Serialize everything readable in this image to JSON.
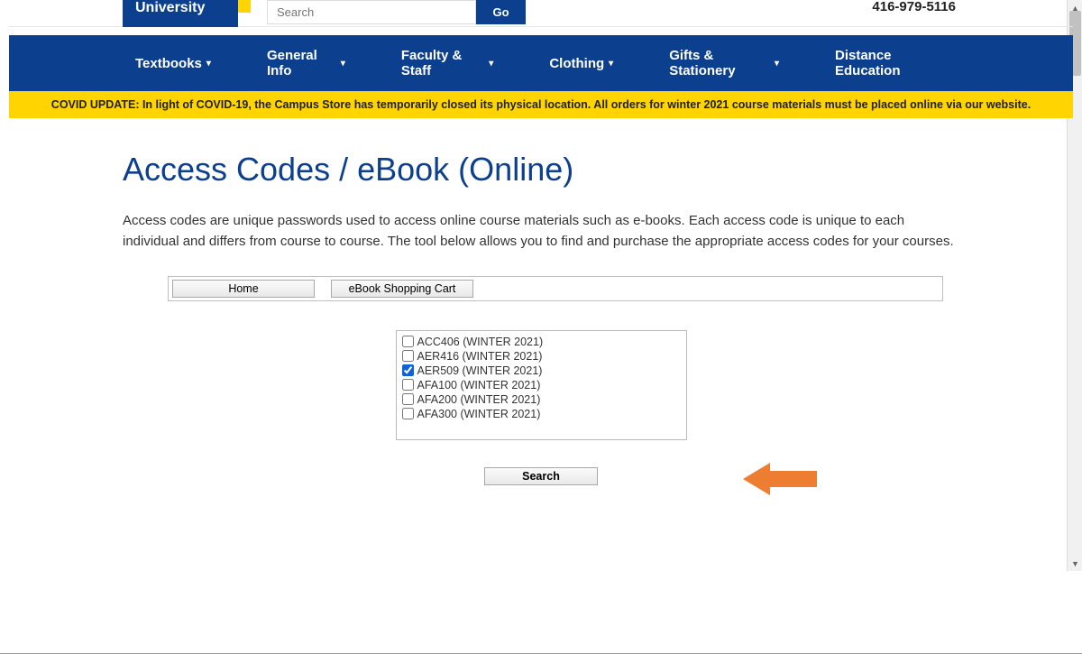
{
  "header": {
    "logo_text": "University",
    "search_placeholder": "Search",
    "search_button": "Go",
    "phone": "416-979-5116"
  },
  "nav": {
    "items": [
      {
        "label": "Textbooks",
        "has_dropdown": true
      },
      {
        "label": "General Info",
        "has_dropdown": true
      },
      {
        "label": "Faculty & Staff",
        "has_dropdown": true
      },
      {
        "label": "Clothing",
        "has_dropdown": true
      },
      {
        "label": "Gifts & Stationery",
        "has_dropdown": true
      },
      {
        "label": "Distance Education",
        "has_dropdown": false
      }
    ]
  },
  "notice": "COVID UPDATE: In light of COVID-19, the Campus Store has temporarily closed its physical location. All orders for winter 2021 course materials must be placed online via our website.",
  "page": {
    "title": "Access Codes / eBook (Online)",
    "intro": "Access codes are unique passwords used to access online course materials such as e-books. Each access code is unique to each individual and differs from course to course. The tool below allows you to find and purchase the appropriate access codes for your courses."
  },
  "tool": {
    "tabs": {
      "home": "Home",
      "cart": "eBook Shopping Cart"
    },
    "courses": [
      {
        "label": "ACC406 (WINTER 2021)",
        "checked": false
      },
      {
        "label": "AER416 (WINTER 2021)",
        "checked": false
      },
      {
        "label": "AER509 (WINTER 2021)",
        "checked": true
      },
      {
        "label": "AFA100 (WINTER 2021)",
        "checked": false
      },
      {
        "label": "AFA200 (WINTER 2021)",
        "checked": false
      },
      {
        "label": "AFA300 (WINTER 2021)",
        "checked": false
      }
    ],
    "search_button": "Search"
  }
}
